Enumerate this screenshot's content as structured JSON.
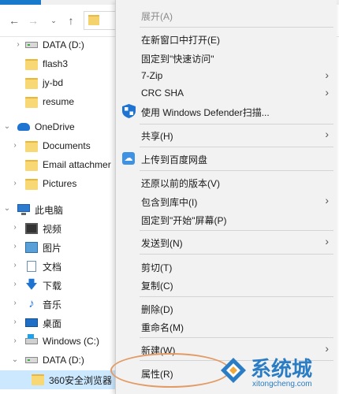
{
  "tree": {
    "items": [
      {
        "label": "DATA (D:)",
        "type": "drive"
      },
      {
        "label": "flash3",
        "type": "folder"
      },
      {
        "label": "jy-bd",
        "type": "folder"
      },
      {
        "label": "resume",
        "type": "folder"
      },
      {
        "label": "OneDrive",
        "type": "cloud"
      },
      {
        "label": "Documents",
        "type": "folder"
      },
      {
        "label": "Email attachmer",
        "type": "folder"
      },
      {
        "label": "Pictures",
        "type": "folder"
      },
      {
        "label": "此电脑",
        "type": "pc"
      },
      {
        "label": "视频",
        "type": "video"
      },
      {
        "label": "图片",
        "type": "pictures"
      },
      {
        "label": "文档",
        "type": "documents"
      },
      {
        "label": "下载",
        "type": "downloads"
      },
      {
        "label": "音乐",
        "type": "music"
      },
      {
        "label": "桌面",
        "type": "desktop"
      },
      {
        "label": "Windows (C:)",
        "type": "windows-drive"
      },
      {
        "label": "DATA (D:)",
        "type": "drive"
      },
      {
        "label": "360安全浏览器",
        "type": "folder",
        "selected": true
      }
    ]
  },
  "menu": {
    "items": [
      {
        "label": "展开(A)",
        "disabled": true
      },
      {
        "label": "在新窗口中打开(E)"
      },
      {
        "label": "固定到\"快速访问\""
      },
      {
        "label": "7-Zip",
        "submenu": true
      },
      {
        "label": "CRC SHA",
        "submenu": true
      },
      {
        "label": "使用 Windows Defender扫描...",
        "icon": "defender-shield-icon"
      },
      {
        "label": "共享(H)",
        "submenu": true
      },
      {
        "label": "上传到百度网盘",
        "icon": "baidu-netdisk-icon"
      },
      {
        "label": "还原以前的版本(V)"
      },
      {
        "label": "包含到库中(I)",
        "submenu": true
      },
      {
        "label": "固定到\"开始\"屏幕(P)"
      },
      {
        "label": "发送到(N)",
        "submenu": true
      },
      {
        "label": "剪切(T)"
      },
      {
        "label": "复制(C)"
      },
      {
        "label": "删除(D)"
      },
      {
        "label": "重命名(M)"
      },
      {
        "label": "新建(W)",
        "submenu": true
      },
      {
        "label": "属性(R)",
        "highlighted": true
      }
    ]
  },
  "watermark": {
    "brand": "系统城",
    "url": "xitongcheng.com"
  },
  "colors": {
    "highlight_circle": "#e39b66",
    "selection": "#cce8ff",
    "watermark": "#2a7cc4"
  }
}
